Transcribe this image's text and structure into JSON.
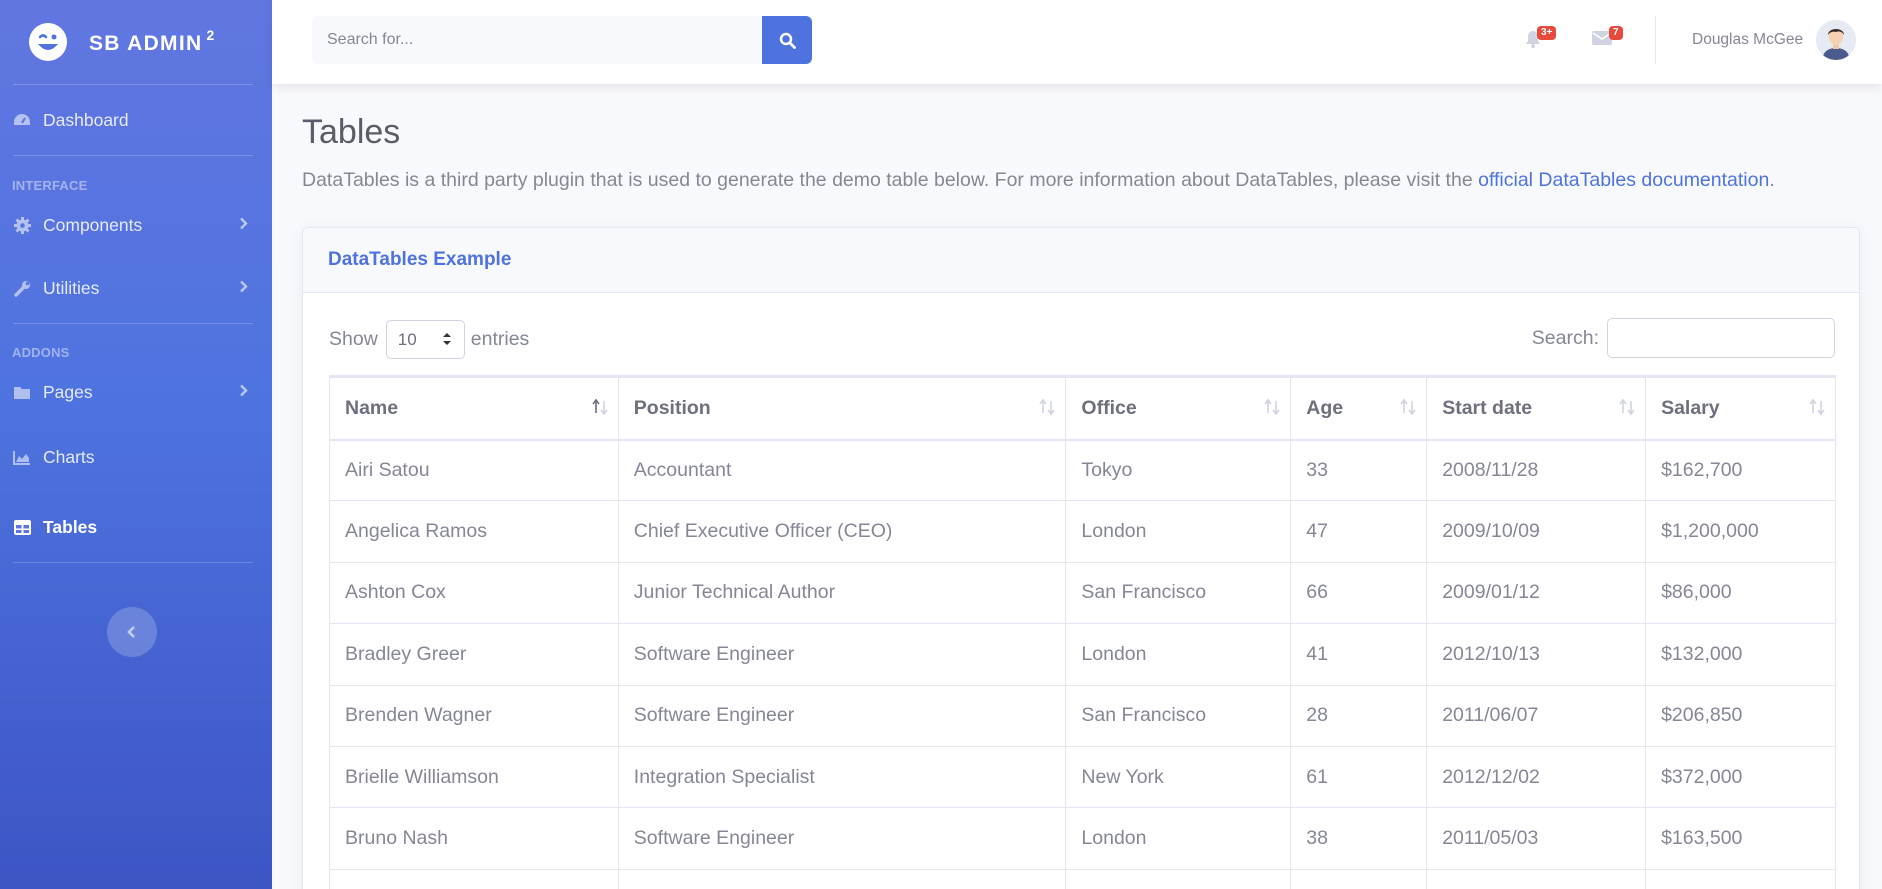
{
  "brand": {
    "name": "SB ADMIN",
    "sup": "2"
  },
  "sidebar": {
    "dashboard": "Dashboard",
    "heading_interface": "INTERFACE",
    "components": "Components",
    "utilities": "Utilities",
    "heading_addons": "ADDONS",
    "pages": "Pages",
    "charts": "Charts",
    "tables": "Tables"
  },
  "topbar": {
    "search_placeholder": "Search for...",
    "alerts_badge": "3+",
    "messages_badge": "7",
    "user_name": "Douglas McGee"
  },
  "page": {
    "title": "Tables",
    "description": "DataTables is a third party plugin that is used to generate the demo table below. For more information about DataTables, please visit the ",
    "link_text": "official DataTables documentation",
    "description_end": "."
  },
  "card": {
    "title": "DataTables Example",
    "show_label": "Show",
    "entries_value": "10",
    "entries_label": "entries",
    "search_label": "Search:"
  },
  "table": {
    "headers": [
      "Name",
      "Position",
      "Office",
      "Age",
      "Start date",
      "Salary"
    ],
    "rows": [
      [
        "Airi Satou",
        "Accountant",
        "Tokyo",
        "33",
        "2008/11/28",
        "$162,700"
      ],
      [
        "Angelica Ramos",
        "Chief Executive Officer (CEO)",
        "London",
        "47",
        "2009/10/09",
        "$1,200,000"
      ],
      [
        "Ashton Cox",
        "Junior Technical Author",
        "San Francisco",
        "66",
        "2009/01/12",
        "$86,000"
      ],
      [
        "Bradley Greer",
        "Software Engineer",
        "London",
        "41",
        "2012/10/13",
        "$132,000"
      ],
      [
        "Brenden Wagner",
        "Software Engineer",
        "San Francisco",
        "28",
        "2011/06/07",
        "$206,850"
      ],
      [
        "Brielle Williamson",
        "Integration Specialist",
        "New York",
        "61",
        "2012/12/02",
        "$372,000"
      ],
      [
        "Bruno Nash",
        "Software Engineer",
        "London",
        "38",
        "2011/05/03",
        "$163,500"
      ],
      [
        "",
        "",
        "",
        "",
        "",
        ""
      ]
    ]
  },
  "colors": {
    "primary": "#4e73df",
    "danger": "#e74a3b",
    "text": "#858796"
  }
}
